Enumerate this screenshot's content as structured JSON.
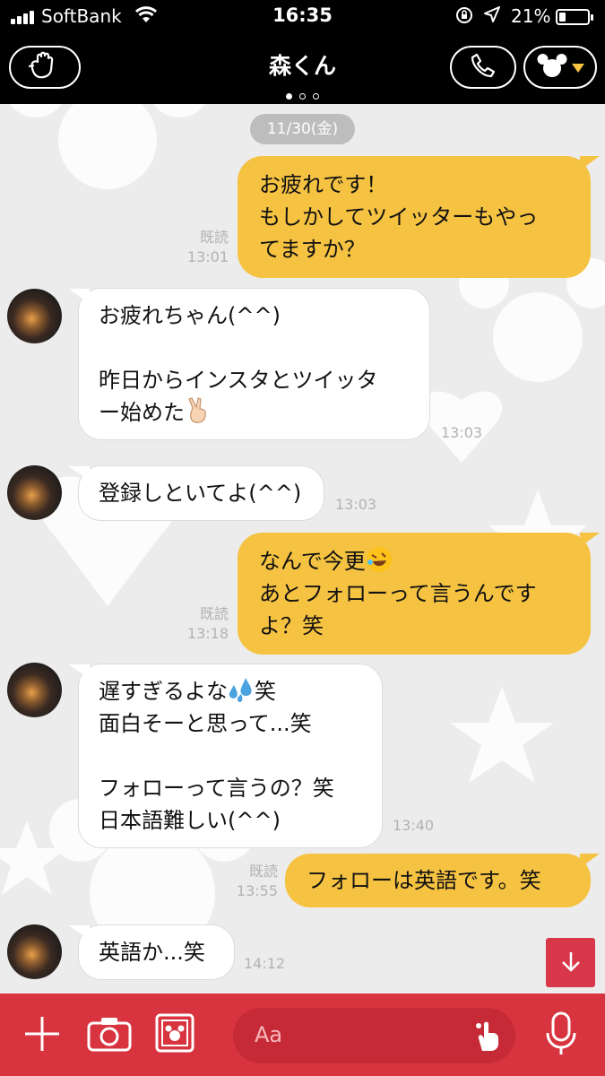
{
  "status_bar": {
    "carrier": "SoftBank",
    "time": "16:35",
    "battery": "21%"
  },
  "header": {
    "title": "森くん",
    "page_dots": 3,
    "active_dot": 0
  },
  "chat": {
    "date": "11/30(金)",
    "messages": [
      {
        "side": "out",
        "text": "お疲れです！\nもしかしてツイッターもやっ\nてますか？",
        "read": "既読",
        "time": "13:01"
      },
      {
        "side": "in",
        "text_before": "お疲れちゃん(^^)\n\n昨日からインスタとツイッタ\nー始めた",
        "emoji": "victory-hand",
        "time": "13:03"
      },
      {
        "side": "in",
        "text": "登録しといてよ(^^)",
        "time": "13:03"
      },
      {
        "side": "out",
        "text_before": "なんで今更",
        "emoji": "rolling-laughing",
        "text_after": "\nあとフォローって言うんです\nよ？笑",
        "read": "既読",
        "time": "13:18"
      },
      {
        "side": "in",
        "text_before": "遅すぎるよな",
        "emoji": "sweat-droplets",
        "text_after": "笑\n面白そーと思って...笑\n\nフォローって言うの？笑\n日本語難しい(^^)",
        "time": "13:40"
      },
      {
        "side": "out",
        "text": "フォローは英語です。笑",
        "read": "既読",
        "time": "13:55"
      },
      {
        "side": "in",
        "text": "英語か...笑",
        "time": "14:12"
      }
    ]
  },
  "input": {
    "placeholder": "Aa"
  },
  "colors": {
    "outgoing_bubble": "#f5c242",
    "incoming_bubble": "#ffffff",
    "bottom_bar": "#d8343f",
    "header": "#000000"
  }
}
